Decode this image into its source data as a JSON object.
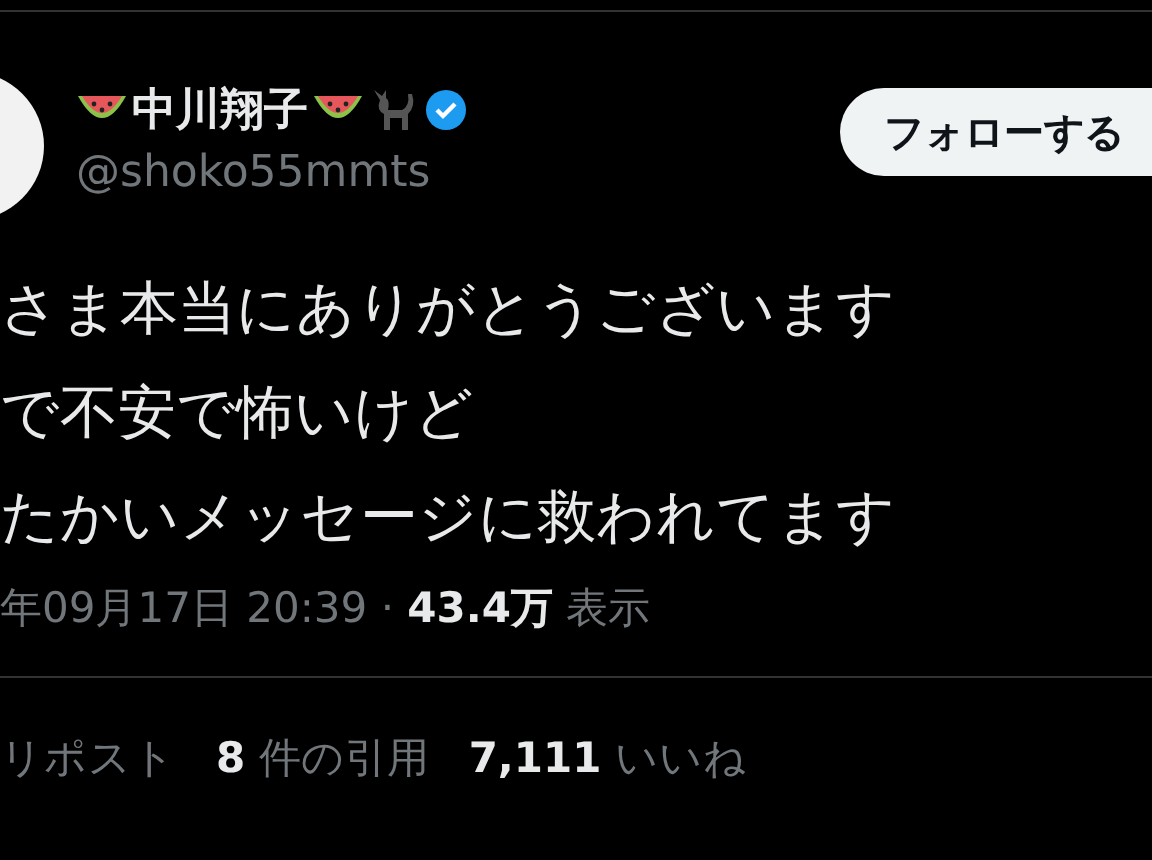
{
  "author": {
    "name": "中川翔子",
    "handle": "@shoko55mmts",
    "verified": true
  },
  "follow_button": {
    "label": "フォローする"
  },
  "body_lines": [
    "さま本当にありがとうございます",
    "で不安で怖いけど",
    "たかいメッセージに救われてます"
  ],
  "meta": "年09月17日 20:39 · **43.4万** 表示",
  "stats": [
    "リポスト",
    "**8** 件の引用",
    "**7,111** いいね"
  ]
}
